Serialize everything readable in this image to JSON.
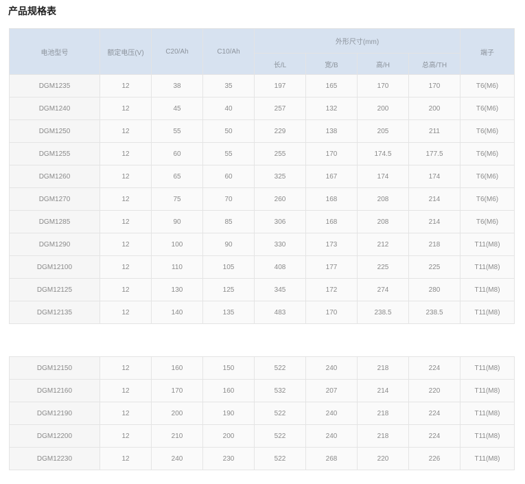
{
  "title": "产品规格表",
  "headers": {
    "model": "电池型号",
    "voltage": "额定电压(V)",
    "c20": "C20/Ah",
    "c10": "C10/Ah",
    "dimensions": "外形尺寸(mm)",
    "length": "长/L",
    "width": "宽/B",
    "height": "高/H",
    "total_height": "总高/TH",
    "terminal": "端子"
  },
  "rows_top": [
    [
      "DGM1235",
      "12",
      "38",
      "35",
      "197",
      "165",
      "170",
      "170",
      "T6(M6)"
    ],
    [
      "DGM1240",
      "12",
      "45",
      "40",
      "257",
      "132",
      "200",
      "200",
      "T6(M6)"
    ],
    [
      "DGM1250",
      "12",
      "55",
      "50",
      "229",
      "138",
      "205",
      "211",
      "T6(M6)"
    ],
    [
      "DGM1255",
      "12",
      "60",
      "55",
      "255",
      "170",
      "174.5",
      "177.5",
      "T6(M6)"
    ],
    [
      "DGM1260",
      "12",
      "65",
      "60",
      "325",
      "167",
      "174",
      "174",
      "T6(M6)"
    ],
    [
      "DGM1270",
      "12",
      "75",
      "70",
      "260",
      "168",
      "208",
      "214",
      "T6(M6)"
    ],
    [
      "DGM1285",
      "12",
      "90",
      "85",
      "306",
      "168",
      "208",
      "214",
      "T6(M6)"
    ],
    [
      "DGM1290",
      "12",
      "100",
      "90",
      "330",
      "173",
      "212",
      "218",
      "T11(M8)"
    ],
    [
      "DGM12100",
      "12",
      "110",
      "105",
      "408",
      "177",
      "225",
      "225",
      "T11(M8)"
    ],
    [
      "DGM12125",
      "12",
      "130",
      "125",
      "345",
      "172",
      "274",
      "280",
      "T11(M8)"
    ],
    [
      "DGM12135",
      "12",
      "140",
      "135",
      "483",
      "170",
      "238.5",
      "238.5",
      "T11(M8)"
    ]
  ],
  "rows_bottom": [
    [
      "DGM12150",
      "12",
      "160",
      "150",
      "522",
      "240",
      "218",
      "224",
      "T11(M8)"
    ],
    [
      "DGM12160",
      "12",
      "170",
      "160",
      "532",
      "207",
      "214",
      "220",
      "T11(M8)"
    ],
    [
      "DGM12190",
      "12",
      "200",
      "190",
      "522",
      "240",
      "218",
      "224",
      "T11(M8)"
    ],
    [
      "DGM12200",
      "12",
      "210",
      "200",
      "522",
      "240",
      "218",
      "224",
      "T11(M8)"
    ],
    [
      "DGM12230",
      "12",
      "240",
      "230",
      "522",
      "268",
      "220",
      "226",
      "T11(M8)"
    ]
  ]
}
